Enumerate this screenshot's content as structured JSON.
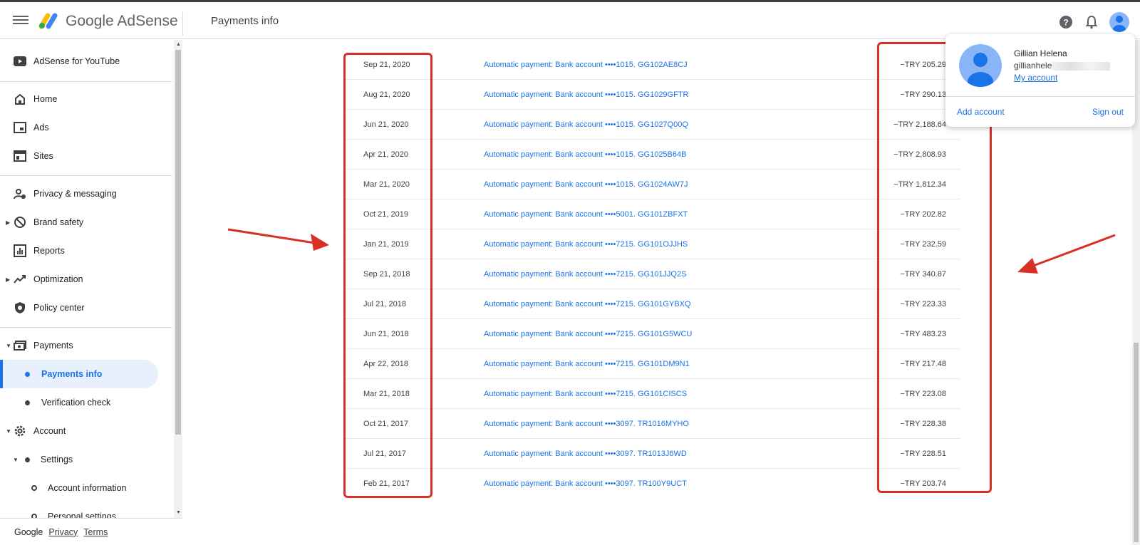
{
  "header": {
    "brand_google": "Google",
    "brand_product": "AdSense",
    "page_title": "Payments info"
  },
  "sidebar": {
    "items": [
      {
        "label": "AdSense for YouTube",
        "icon": "youtube-icon"
      },
      {
        "label": "Home",
        "icon": "home-icon"
      },
      {
        "label": "Ads",
        "icon": "ads-icon"
      },
      {
        "label": "Sites",
        "icon": "sites-icon"
      },
      {
        "label": "Privacy & messaging",
        "icon": "privacy-icon"
      },
      {
        "label": "Brand safety",
        "icon": "block-icon"
      },
      {
        "label": "Reports",
        "icon": "bar-chart-icon"
      },
      {
        "label": "Optimization",
        "icon": "trending-icon"
      },
      {
        "label": "Policy center",
        "icon": "shield-icon"
      },
      {
        "label": "Payments",
        "icon": "payments-icon"
      },
      {
        "label": "Payments info",
        "icon": "dot-icon"
      },
      {
        "label": "Verification check",
        "icon": "dot-icon"
      },
      {
        "label": "Account",
        "icon": "gear-icon"
      },
      {
        "label": "Settings",
        "icon": "dot-icon"
      },
      {
        "label": "Account information",
        "icon": "ring-icon"
      },
      {
        "label": "Personal settings",
        "icon": "ring-icon"
      }
    ]
  },
  "footer": {
    "google": "Google",
    "privacy": "Privacy",
    "terms": "Terms"
  },
  "payments": [
    {
      "date": "Sep 21, 2020",
      "desc": "Automatic payment: Bank account ••••1015. GG102AE8CJ",
      "amount": "−TRY 205.29"
    },
    {
      "date": "Aug 21, 2020",
      "desc": "Automatic payment: Bank account ••••1015. GG1029GFTR",
      "amount": "−TRY 290.13"
    },
    {
      "date": "Jun 21, 2020",
      "desc": "Automatic payment: Bank account ••••1015. GG1027Q00Q",
      "amount": "−TRY 2,188.64"
    },
    {
      "date": "Apr 21, 2020",
      "desc": "Automatic payment: Bank account ••••1015. GG1025B64B",
      "amount": "−TRY 2,808.93"
    },
    {
      "date": "Mar 21, 2020",
      "desc": "Automatic payment: Bank account ••••1015. GG1024AW7J",
      "amount": "−TRY 1,812.34"
    },
    {
      "date": "Oct 21, 2019",
      "desc": "Automatic payment: Bank account ••••5001. GG101ZBFXT",
      "amount": "−TRY 202.82"
    },
    {
      "date": "Jan 21, 2019",
      "desc": "Automatic payment: Bank account ••••7215. GG101OJJHS",
      "amount": "−TRY 232.59"
    },
    {
      "date": "Sep 21, 2018",
      "desc": "Automatic payment: Bank account ••••7215. GG101JJQ2S",
      "amount": "−TRY 340.87"
    },
    {
      "date": "Jul 21, 2018",
      "desc": "Automatic payment: Bank account ••••7215. GG101GYBXQ",
      "amount": "−TRY 223.33"
    },
    {
      "date": "Jun 21, 2018",
      "desc": "Automatic payment: Bank account ••••7215. GG101G5WCU",
      "amount": "−TRY 483.23"
    },
    {
      "date": "Apr 22, 2018",
      "desc": "Automatic payment: Bank account ••••7215. GG101DM9N1",
      "amount": "−TRY 217.48"
    },
    {
      "date": "Mar 21, 2018",
      "desc": "Automatic payment: Bank account ••••7215. GG101CISCS",
      "amount": "−TRY 223.08"
    },
    {
      "date": "Oct 21, 2017",
      "desc": "Automatic payment: Bank account ••••3097. TR1016MYHO",
      "amount": "−TRY 228.38"
    },
    {
      "date": "Jul 21, 2017",
      "desc": "Automatic payment: Bank account ••••3097. TR1013J6WD",
      "amount": "−TRY 228.51"
    },
    {
      "date": "Feb 21, 2017",
      "desc": "Automatic payment: Bank account ••••3097. TR100Y9UCT",
      "amount": "−TRY 203.74"
    }
  ],
  "account_popup": {
    "name": "Gillian Helena",
    "email_visible": "gillianhele",
    "my_account": "My account",
    "add_account": "Add account",
    "sign_out": "Sign out"
  },
  "colors": {
    "accent": "#1a73e8",
    "annotation_red": "#d93025"
  }
}
